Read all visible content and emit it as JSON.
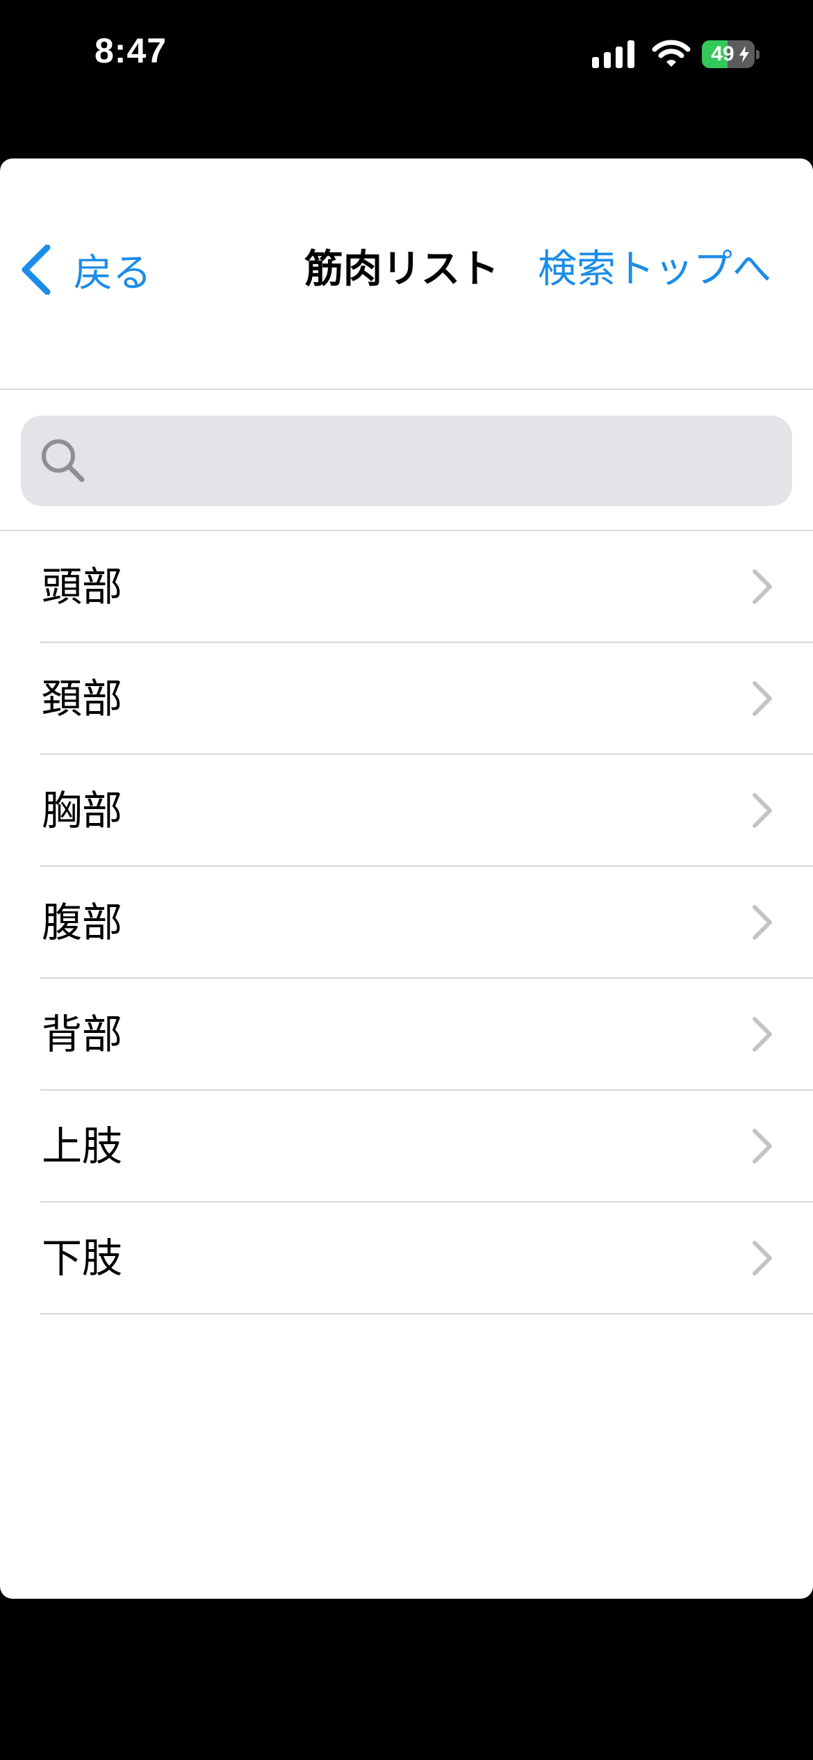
{
  "status_bar": {
    "time": "8:47",
    "battery_level": 49,
    "battery_text": "49",
    "battery_color": "#34c759",
    "icons": [
      "signal-icon",
      "wifi-icon",
      "battery-icon"
    ]
  },
  "nav": {
    "back_label": "戻る",
    "title": "筋肉リスト",
    "top_link_label": "検索トップへ",
    "accent_color": "#1b8ce8"
  },
  "search": {
    "value": "",
    "placeholder": ""
  },
  "list": {
    "items": [
      {
        "label": "頭部"
      },
      {
        "label": "頚部"
      },
      {
        "label": "胸部"
      },
      {
        "label": "腹部"
      },
      {
        "label": "背部"
      },
      {
        "label": "上肢"
      },
      {
        "label": "下肢"
      }
    ]
  }
}
